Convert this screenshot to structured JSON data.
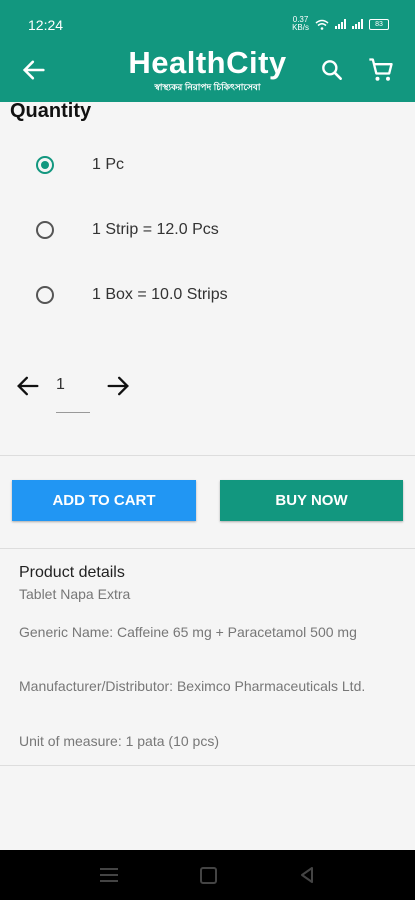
{
  "status_bar": {
    "time": "12:24",
    "network_speed": "0.37\nKB/s",
    "battery": "83"
  },
  "header": {
    "brand_name": "HealthCity",
    "brand_tagline": "স্বাস্থ্যকর নিরাপদ চিকিৎসাসেবা"
  },
  "quantity": {
    "title": "Quantity",
    "options": [
      {
        "label": "1 Pc",
        "selected": true
      },
      {
        "label": "1 Strip = 12.0 Pcs",
        "selected": false
      },
      {
        "label": "1 Box = 10.0 Strips",
        "selected": false
      }
    ],
    "value": "1"
  },
  "actions": {
    "add_to_cart": "ADD TO CART",
    "buy_now": "BUY NOW"
  },
  "details": {
    "title": "Product details",
    "product_name": "Tablet Napa Extra",
    "generic_name": "Generic Name: Caffeine 65 mg + Paracetamol 500 mg",
    "manufacturer": "Manufacturer/Distributor: Beximco Pharmaceuticals Ltd.",
    "unit": "Unit of measure: 1 pata (10 pcs)"
  },
  "colors": {
    "primary": "#12977f",
    "accent": "#2196f3"
  }
}
